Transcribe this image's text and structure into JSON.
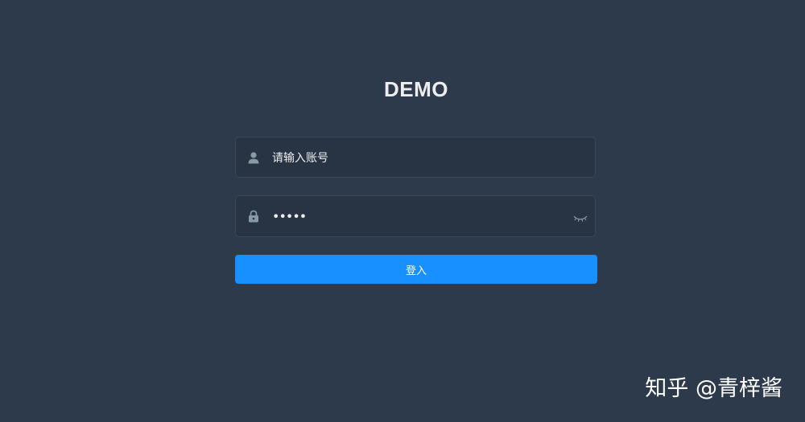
{
  "title": "DEMO",
  "username": {
    "placeholder": "请输入账号",
    "icon": "user-icon"
  },
  "password": {
    "value": "•••••",
    "icon": "lock-icon",
    "toggle_icon": "eye-closed-icon"
  },
  "login_button": {
    "label": "登入"
  },
  "watermark": "知乎 @青梓酱",
  "colors": {
    "background": "#2d3a4b",
    "input_background": "#283443",
    "button": "#1890ff",
    "icon": "#889aa4"
  }
}
